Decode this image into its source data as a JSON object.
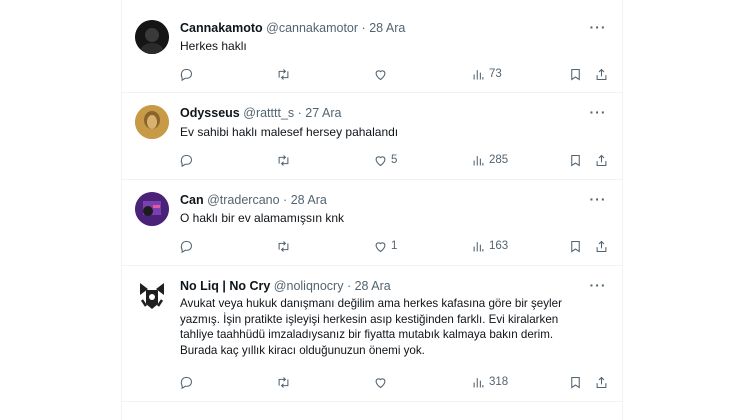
{
  "tweets": [
    {
      "name": "Cannakamoto",
      "handle": "@cannakamotor",
      "date": "28 Ara",
      "text": [
        "Herkes haklı"
      ],
      "likes": "",
      "views": "73",
      "avatar_color": "#1a1a1a"
    },
    {
      "name": "Odysseus",
      "handle": "@ratttt_s",
      "date": "27 Ara",
      "text": [
        "Ev sahibi haklı malesef hersey pahalandı"
      ],
      "likes": "5",
      "views": "285",
      "avatar_color": "#b98a3c"
    },
    {
      "name": "Can",
      "handle": "@tradercano",
      "date": "28 Ara",
      "text": [
        "O haklı bir ev alamamışsın knk"
      ],
      "likes": "1",
      "views": "163",
      "avatar_color": "#5a2d8c"
    },
    {
      "name": "No Liq | No Cry",
      "handle": "@noliqnocry",
      "date": "28 Ara",
      "text": [
        "Avukat veya hukuk danışmanı değilim ama herkes kafasına göre bir şeyler",
        "yazmış. İşin pratikte işleyişi herkesin asıp kestiğinden farklı. Evi kiralarken",
        "tahliye taahhüdü imzaladıysanız bir fiyatta mutabık kalmaya bakın derim.",
        "Burada kaç yıllık kiracı olduğunuzun önemi yok."
      ],
      "likes": "",
      "views": "318",
      "avatar_color": "#222222"
    }
  ],
  "separator": "·",
  "icons": {
    "reply": "reply-icon",
    "retweet": "retweet-icon",
    "like": "heart-icon",
    "views": "views-icon",
    "bookmark": "bookmark-icon",
    "share": "share-icon",
    "more": "more-icon"
  }
}
